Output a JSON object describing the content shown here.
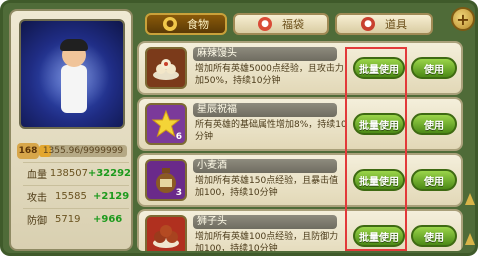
{
  "hero": {
    "level": "168",
    "exp_text": "1355.96/9999999",
    "exp_fraction": 0.14,
    "stats": [
      {
        "label": "血量",
        "value": "138507",
        "bonus": "+32292"
      },
      {
        "label": "攻击",
        "value": "15585",
        "bonus": "+2129"
      },
      {
        "label": "防御",
        "value": "5719",
        "bonus": "+966"
      }
    ]
  },
  "tabs": [
    {
      "label": "食物",
      "icon": "food-icon"
    },
    {
      "label": "福袋",
      "icon": "lucky-bag-icon"
    },
    {
      "label": "道具",
      "icon": "item-icon"
    }
  ],
  "items": [
    {
      "name": "麻辣馒头",
      "desc": "增加所有英雄5000点经验，且攻击力加50%，持续10分钟",
      "count": "",
      "icon": "dumpling-plate-icon",
      "thumb_color": "#7b3a1a",
      "batch_label": "批量使用",
      "use_label": "使用"
    },
    {
      "name": "星辰祝福",
      "desc": "所有英雄的基础属性增加8%，持续10分钟",
      "count": "6",
      "icon": "star-icon",
      "thumb_color": "#7b3a9a",
      "batch_label": "批量使用",
      "use_label": "使用"
    },
    {
      "name": "小麦酒",
      "desc": "增加所有英雄150点经验，且暴击值加100，持续10分钟",
      "count": "3",
      "icon": "wine-jar-icon",
      "thumb_color": "#6a2a8a",
      "batch_label": "批量使用",
      "use_label": "使用"
    },
    {
      "name": "狮子头",
      "desc": "增加所有英雄100点经验，且防御力加100，持续10分钟",
      "count": "",
      "icon": "meatball-icon",
      "thumb_color": "#b0301f",
      "batch_label": "批量使用",
      "use_label": "使用"
    }
  ],
  "colors": {
    "frame": "#4f6b38",
    "button_green": "#4c8a16",
    "highlight_red": "#e23a3a",
    "bonus_green": "#1d9a1d"
  }
}
